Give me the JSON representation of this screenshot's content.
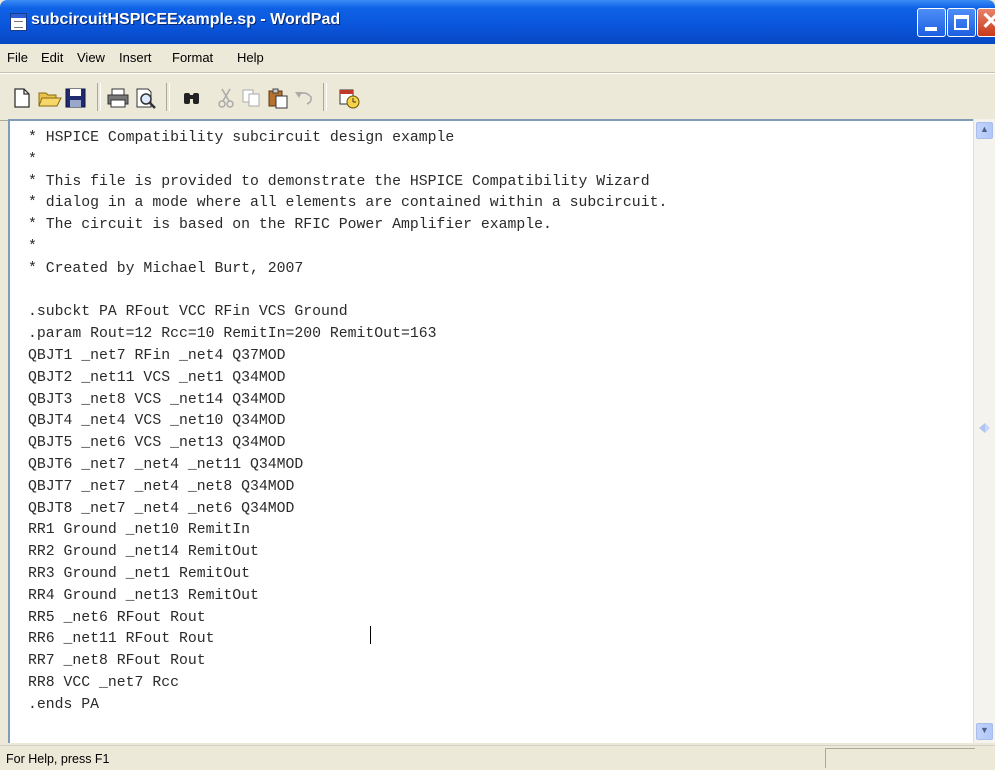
{
  "window": {
    "title": "subcircuitHSPICEExample.sp - WordPad"
  },
  "menu": [
    "File",
    "Edit",
    "View",
    "Insert",
    "Format",
    "Help"
  ],
  "toolbar": {
    "icons": [
      "new-document-icon",
      "open-folder-icon",
      "save-disk-icon",
      "print-icon",
      "print-preview-icon",
      "find-binoculars-icon",
      "cut-scissors-icon",
      "copy-icon",
      "paste-icon",
      "undo-icon",
      "insert-date-time-icon"
    ]
  },
  "document": {
    "lines": [
      "* HSPICE Compatibility subcircuit design example",
      "*",
      "* This file is provided to demonstrate the HSPICE Compatibility Wizard",
      "* dialog in a mode where all elements are contained within a subcircuit.",
      "* The circuit is based on the RFIC Power Amplifier example.",
      "*",
      "* Created by Michael Burt, 2007",
      "",
      ".subckt PA RFout VCC RFin VCS Ground",
      ".param Rout=12 Rcc=10 RemitIn=200 RemitOut=163",
      "QBJT1 _net7 RFin _net4 Q37MOD",
      "QBJT2 _net11 VCS _net1 Q34MOD",
      "QBJT3 _net8 VCS _net14 Q34MOD",
      "QBJT4 _net4 VCS _net10 Q34MOD",
      "QBJT5 _net6 VCS _net13 Q34MOD",
      "QBJT6 _net7 _net4 _net11 Q34MOD",
      "QBJT7 _net7 _net4 _net8 Q34MOD",
      "QBJT8 _net7 _net4 _net6 Q34MOD",
      "RR1 Ground _net10 RemitIn",
      "RR2 Ground _net14 RemitOut",
      "RR3 Ground _net1 RemitOut",
      "RR4 Ground _net13 RemitOut",
      "RR5 _net6 RFout Rout",
      "RR6 _net11 RFout Rout",
      "RR7 _net8 RFout Rout",
      "RR8 VCC _net7 Rcc",
      ".ends PA"
    ]
  },
  "status": {
    "text": "For Help, press F1"
  }
}
